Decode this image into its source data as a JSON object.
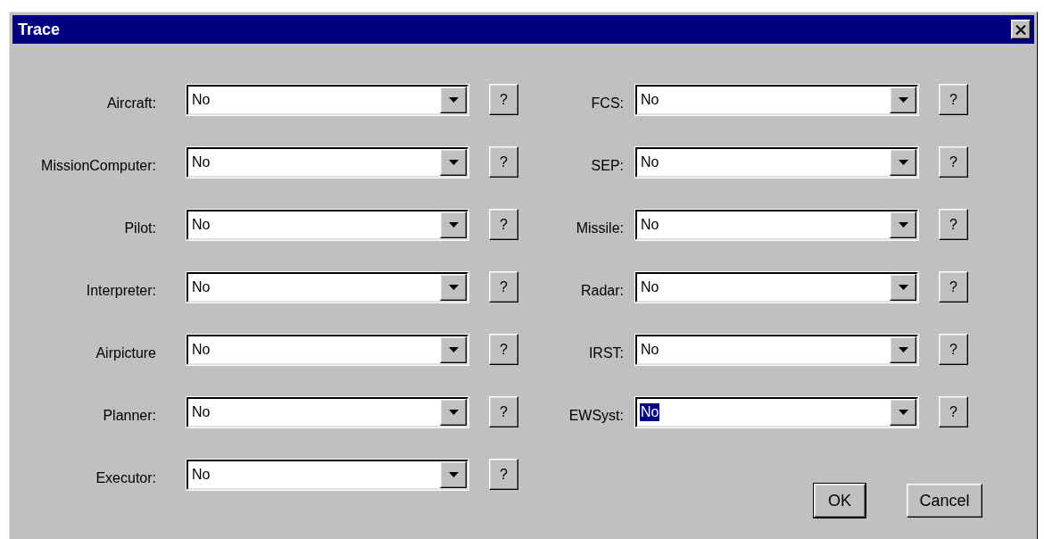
{
  "window": {
    "title": "Trace"
  },
  "left_fields": [
    {
      "label": "Aircraft:",
      "value": "No",
      "help": "?",
      "focused": false
    },
    {
      "label": "MissionComputer:",
      "value": "No",
      "help": "?",
      "focused": false
    },
    {
      "label": "Pilot:",
      "value": "No",
      "help": "?",
      "focused": false
    },
    {
      "label": "Interpreter:",
      "value": "No",
      "help": "?",
      "focused": false
    },
    {
      "label": "Airpicture",
      "value": "No",
      "help": "?",
      "focused": false
    },
    {
      "label": "Planner:",
      "value": "No",
      "help": "?",
      "focused": false
    },
    {
      "label": "Executor:",
      "value": "No",
      "help": "?",
      "focused": false
    }
  ],
  "right_fields": [
    {
      "label": "FCS:",
      "value": "No",
      "help": "?",
      "focused": false
    },
    {
      "label": "SEP:",
      "value": "No",
      "help": "?",
      "focused": false
    },
    {
      "label": "Missile:",
      "value": "No",
      "help": "?",
      "focused": false
    },
    {
      "label": "Radar:",
      "value": "No",
      "help": "?",
      "focused": false
    },
    {
      "label": "IRST:",
      "value": "No",
      "help": "?",
      "focused": false
    },
    {
      "label": "EWSyst:",
      "value": "No",
      "help": "?",
      "focused": true
    }
  ],
  "buttons": [
    {
      "label": "OK",
      "default": true
    },
    {
      "label": "Cancel",
      "default": false
    }
  ]
}
